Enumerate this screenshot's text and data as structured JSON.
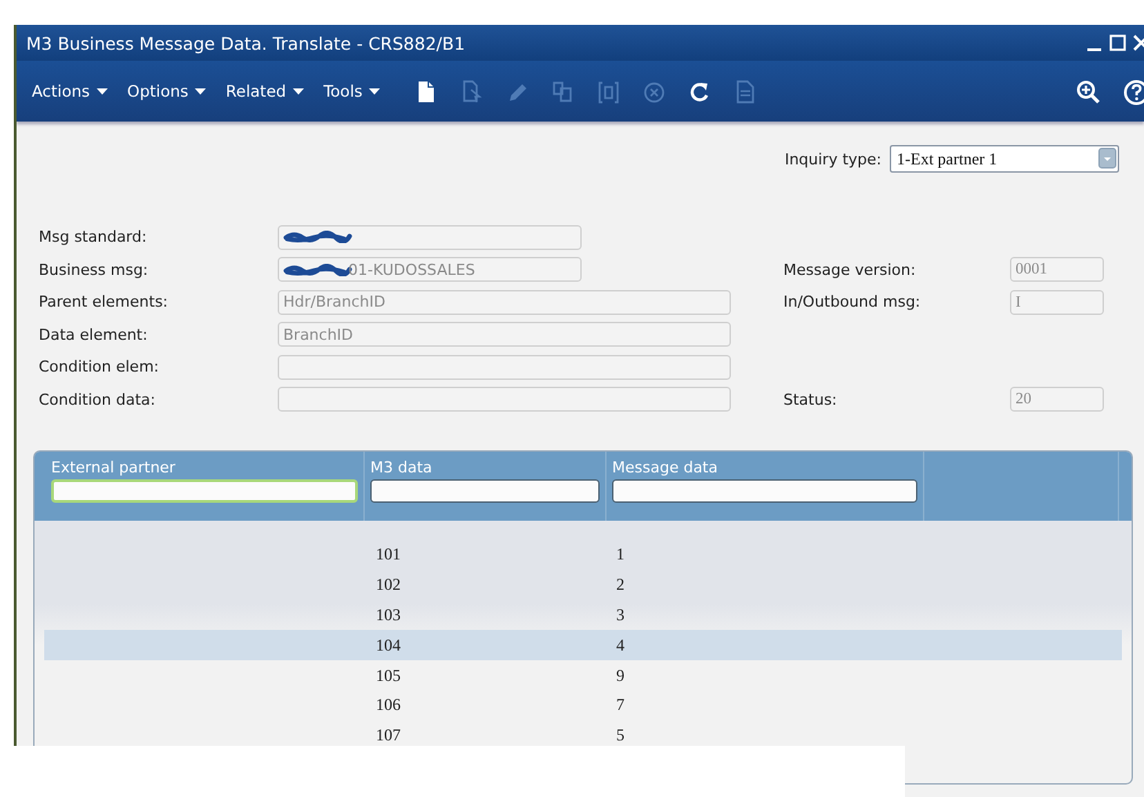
{
  "window": {
    "title": "M3 Business Message Data. Translate - CRS882/B1"
  },
  "menus": [
    {
      "label": "Actions"
    },
    {
      "label": "Options"
    },
    {
      "label": "Related"
    },
    {
      "label": "Tools"
    }
  ],
  "tools": [
    {
      "kind": "new",
      "disabled": false
    },
    {
      "kind": "select",
      "disabled": true
    },
    {
      "kind": "edit",
      "disabled": true
    },
    {
      "kind": "copy",
      "disabled": true
    },
    {
      "kind": "display",
      "disabled": true
    },
    {
      "kind": "delete",
      "disabled": true
    },
    {
      "kind": "refresh",
      "disabled": false
    },
    {
      "kind": "document",
      "disabled": true
    }
  ],
  "right_tools": [
    {
      "kind": "zoom",
      "disabled": false
    },
    {
      "kind": "help",
      "disabled": false
    }
  ],
  "inquiry_type": {
    "label": "Inquiry type:",
    "value": "1-Ext partner 1"
  },
  "form_rows": [
    {
      "left": {
        "label": "Msg standard:",
        "kind": "short",
        "redacted": true
      }
    },
    {
      "left": {
        "label": "Business msg:",
        "kind": "short",
        "redacted": true,
        "value": "01-KUDOSSALES"
      },
      "right": {
        "label": "Message version:",
        "value": "0001"
      }
    },
    {
      "left": {
        "label": "Parent elements:",
        "kind": "long",
        "value": "Hdr/BranchID"
      },
      "right": {
        "label": "In/Outbound msg:",
        "value": "I"
      }
    },
    {
      "left": {
        "label": "Data element:",
        "kind": "long",
        "value": "BranchID"
      }
    },
    {
      "left": {
        "label": "Condition elem:",
        "kind": "long"
      }
    },
    {
      "left": {
        "label": "Condition data:",
        "kind": "long"
      },
      "right": {
        "label": "Status:",
        "value": "20"
      }
    }
  ],
  "table": {
    "columns": [
      {
        "label": "External partner",
        "focused": true
      },
      {
        "label": "M3 data",
        "focused": false
      },
      {
        "label": "Message data",
        "focused": false
      }
    ],
    "rows": [
      {
        "m3_data": "101",
        "message_data": "1",
        "selected": false
      },
      {
        "m3_data": "102",
        "message_data": "2",
        "selected": false
      },
      {
        "m3_data": "103",
        "message_data": "3",
        "selected": false
      },
      {
        "m3_data": "104",
        "message_data": "4",
        "selected": true
      },
      {
        "m3_data": "105",
        "message_data": "9",
        "selected": false
      },
      {
        "m3_data": "106",
        "message_data": "7",
        "selected": false
      },
      {
        "m3_data": "107",
        "message_data": "5",
        "selected": false
      }
    ]
  }
}
